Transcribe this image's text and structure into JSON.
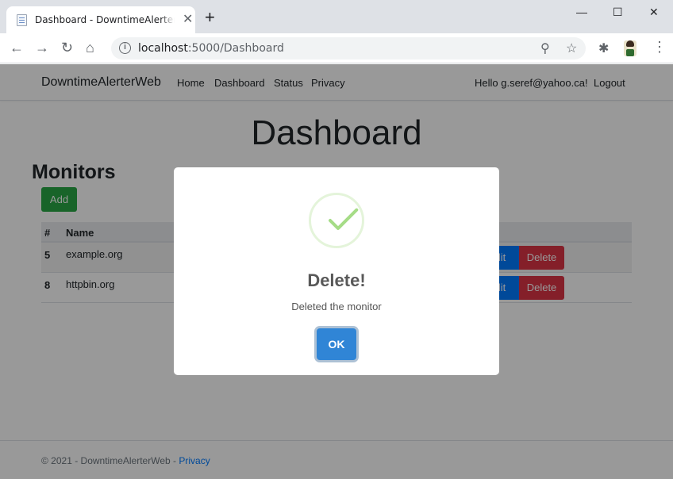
{
  "browser": {
    "tab_title": "Dashboard - DowntimeAlerterWeb",
    "tab_close": "✕",
    "new_tab": "+",
    "url_host": "localhost",
    "url_path": ":5000/Dashboard",
    "window": {
      "minimize": "—",
      "maximize": "☐",
      "close": "✕"
    },
    "icons": {
      "back": "←",
      "forward": "→",
      "reload": "↻",
      "home": "⌂",
      "zoom": "⚲",
      "bookmark": "☆",
      "extensions": "✱",
      "menu": "⋮",
      "info": "i"
    }
  },
  "navbar": {
    "brand": "DowntimeAlerterWeb",
    "links": [
      "Home",
      "Dashboard",
      "Status",
      "Privacy"
    ],
    "greeting": "Hello g.seref@yahoo.ca!",
    "logout": "Logout"
  },
  "page": {
    "title": "Dashboard",
    "section_title": "Monitors",
    "add_label": "Add"
  },
  "table": {
    "headers": [
      "#",
      "Name"
    ],
    "rows": [
      {
        "id": "5",
        "name": "example.org",
        "edit": "Edit",
        "delete": "Delete"
      },
      {
        "id": "8",
        "name": "httpbin.org",
        "edit": "Edit",
        "delete": "Delete"
      }
    ]
  },
  "footer": {
    "text": "© 2021 - DowntimeAlerterWeb - ",
    "link": "Privacy"
  },
  "modal": {
    "title": "Delete!",
    "message": "Deleted the monitor",
    "ok_label": "OK"
  },
  "colors": {
    "success": "#28a745",
    "primary": "#007bff",
    "danger": "#dc3545",
    "confirm": "#3085d6",
    "check": "#a5dc86"
  }
}
